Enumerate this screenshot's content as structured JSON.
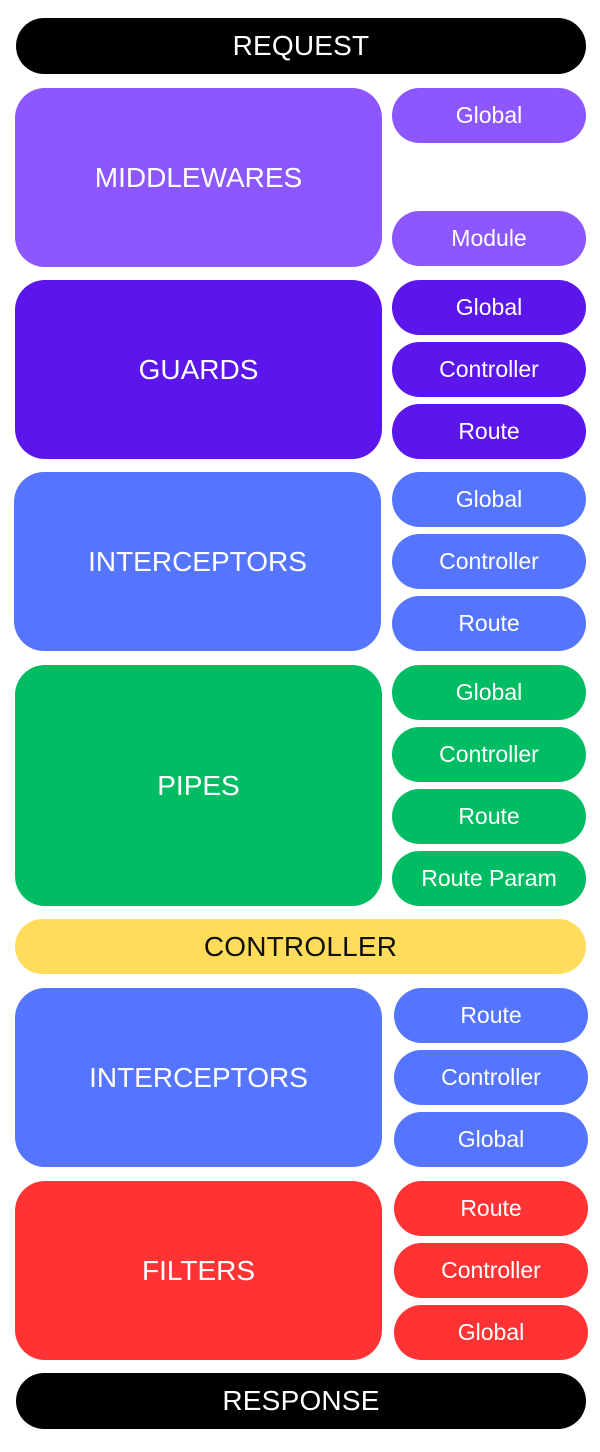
{
  "request": {
    "label": "REQUEST"
  },
  "response": {
    "label": "RESPONSE"
  },
  "controller": {
    "label": "CONTROLLER",
    "color": "#ffdc5a"
  },
  "stages": [
    {
      "id": "middlewares",
      "label": "MIDDLEWARES",
      "color": "#8c57ff",
      "scopes": [
        "Global",
        "Module"
      ]
    },
    {
      "id": "guards",
      "label": "GUARDS",
      "color": "#5b16ec",
      "scopes": [
        "Global",
        "Controller",
        "Route"
      ]
    },
    {
      "id": "interceptors-in",
      "label": "INTERCEPTORS",
      "color": "#5575ff",
      "scopes": [
        "Global",
        "Controller",
        "Route"
      ]
    },
    {
      "id": "pipes",
      "label": "PIPES",
      "color": "#00bd63",
      "scopes": [
        "Global",
        "Controller",
        "Route",
        "Route Param"
      ]
    },
    {
      "id": "interceptors-out",
      "label": "INTERCEPTORS",
      "color": "#5575ff",
      "scopes": [
        "Route",
        "Controller",
        "Global"
      ]
    },
    {
      "id": "filters",
      "label": "FILTERS",
      "color": "#ff3333",
      "scopes": [
        "Route",
        "Controller",
        "Global"
      ]
    }
  ]
}
